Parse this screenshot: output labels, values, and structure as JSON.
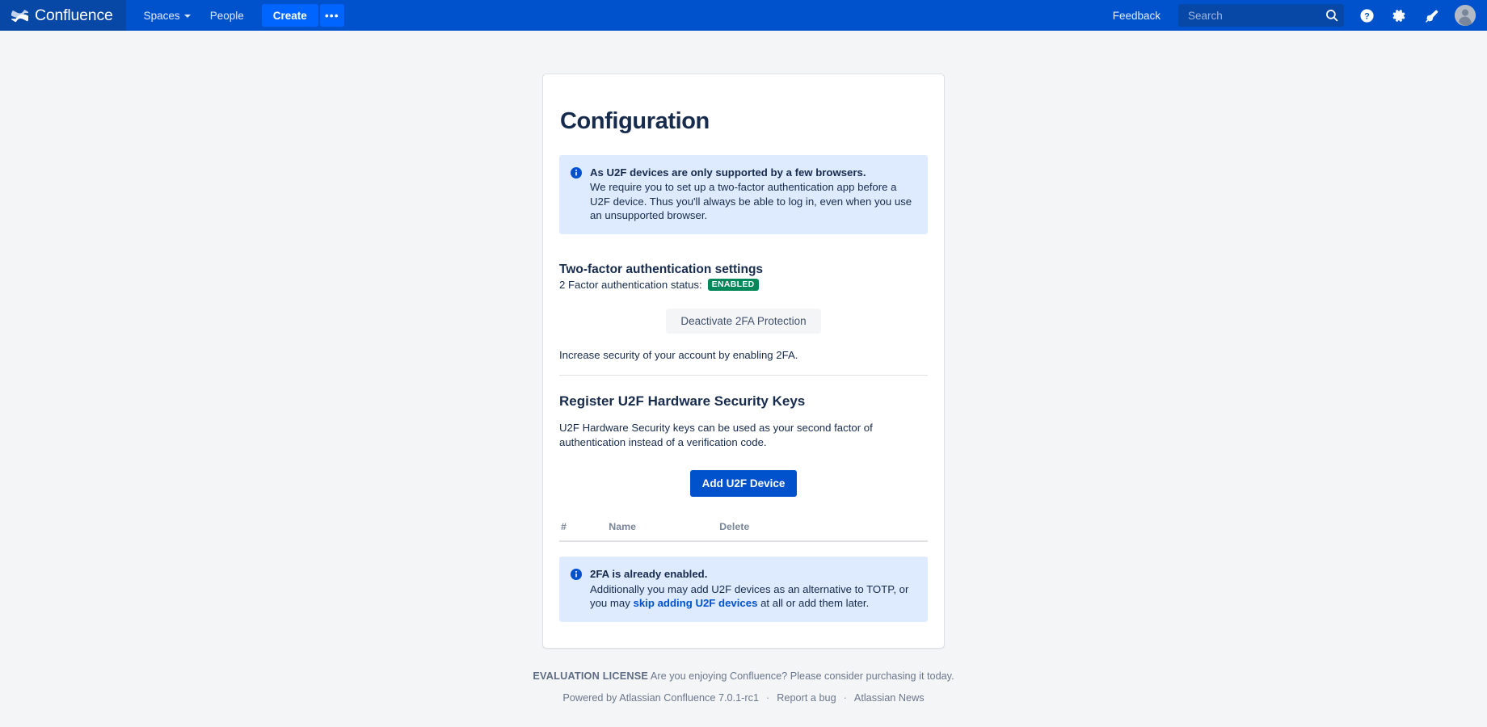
{
  "nav": {
    "logo_text": "Confluence",
    "logo_icon": "confluence-logo-icon",
    "spaces_label": "Spaces",
    "people_label": "People",
    "create_label": "Create",
    "more_label": "•••",
    "feedback_label": "Feedback",
    "search_placeholder": "Search",
    "search_value": "",
    "search_icon": "search-icon",
    "help_icon": "help-circle-icon",
    "settings_icon": "gear-icon",
    "notifications_icon": "megaphone-icon",
    "avatar_icon": "user-avatar-icon",
    "bg_color": "#0052CC",
    "logo_bg_color": "#0747A6",
    "create_color": "#0065FF"
  },
  "page": {
    "title": "Configuration"
  },
  "info_banner": {
    "icon": "info-circle-icon",
    "title": "As U2F devices are only supported by a few browsers.",
    "text": "We require you to set up a two-factor authentication app before a U2F device. Thus you'll always be able to log in, even when you use an unsupported browser.",
    "bg_color": "#DEEBFF"
  },
  "twofa_section": {
    "title": "Two-factor authentication settings",
    "status_label": "2 Factor authentication status:",
    "status_badge": "ENABLED",
    "status_badge_color": "#00875A",
    "deactivate_button": "Deactivate 2FA Protection",
    "helper_text": "Increase security of your account by enabling 2FA."
  },
  "u2f_section": {
    "title": "Register U2F Hardware Security Keys",
    "description": "U2F Hardware Security keys can be used as your second factor of authentication instead of a verification code.",
    "add_button": "Add U2F Device",
    "add_button_color": "#0052CC",
    "table": {
      "headers": [
        "#",
        "Name",
        "Delete"
      ],
      "rows": []
    }
  },
  "enabled_banner": {
    "icon": "info-circle-icon",
    "title": "2FA is already enabled.",
    "text_before": "Additionally you may add U2F devices as an alternative to TOTP, or you may ",
    "link_text": "skip adding U2F devices",
    "text_after": " at all or add them later.",
    "bg_color": "#DEEBFF"
  },
  "footer": {
    "license_label": "EVALUATION LICENSE",
    "license_text": "Are you enjoying Confluence? Please consider purchasing it today.",
    "powered_by": "Powered by Atlassian Confluence 7.0.1-rc1",
    "report_bug": "Report a bug",
    "atlassian_news": "Atlassian News",
    "separator": "·"
  }
}
